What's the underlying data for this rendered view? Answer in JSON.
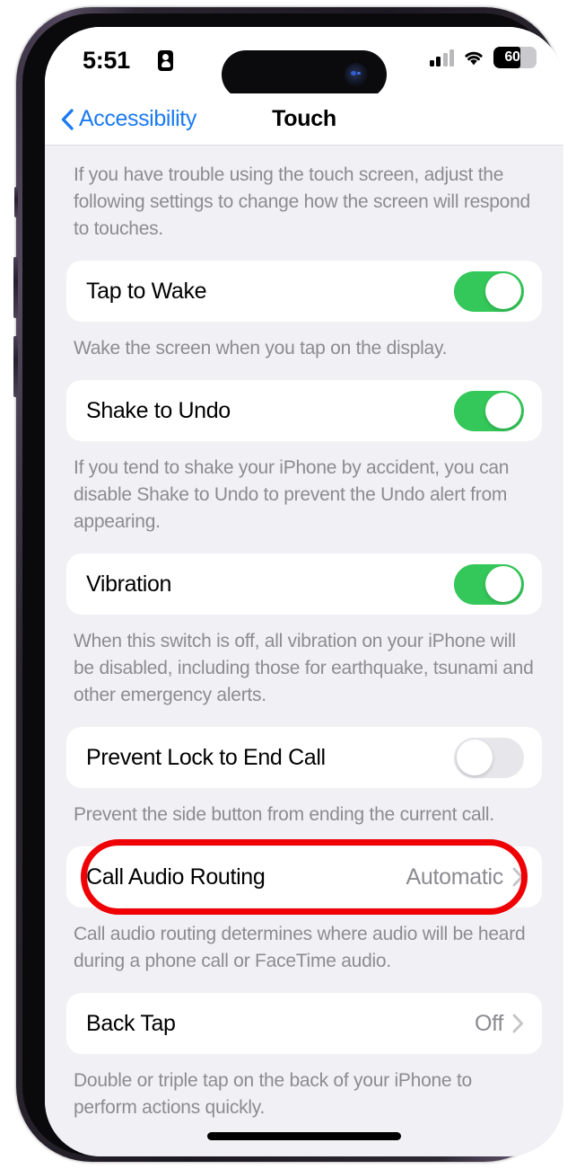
{
  "status_bar": {
    "time": "5:51",
    "lock_icon": "privacy-lock-icon",
    "signal_icon": "cellular-signal-icon",
    "wifi_icon": "wifi-icon",
    "battery_level": "60",
    "battery_percent": 60
  },
  "nav": {
    "back_label": "Accessibility",
    "back_icon": "chevron-left-icon",
    "title": "Touch"
  },
  "intro_text": "If you have trouble using the touch screen, adjust the following settings to change how the screen will respond to touches.",
  "rows": [
    {
      "label": "Tap to Wake",
      "type": "toggle",
      "value": "on",
      "footer": "Wake the screen when you tap on the display."
    },
    {
      "label": "Shake to Undo",
      "type": "toggle",
      "value": "on",
      "footer": "If you tend to shake your iPhone by accident, you can disable Shake to Undo to prevent the Undo alert from appearing."
    },
    {
      "label": "Vibration",
      "type": "toggle",
      "value": "on",
      "footer": "When this switch is off, all vibration on your iPhone will be disabled, including those for earthquake, tsunami and other emergency alerts."
    },
    {
      "label": "Prevent Lock to End Call",
      "type": "toggle",
      "value": "off",
      "footer": "Prevent the side button from ending the current call."
    },
    {
      "label": "Call Audio Routing",
      "type": "disclosure",
      "value": "Automatic",
      "footer": "Call audio routing determines where audio will be heard during a phone call or FaceTime audio.",
      "highlighted": true
    },
    {
      "label": "Back Tap",
      "type": "disclosure",
      "value": "Off",
      "footer": "Double or triple tap on the back of your iPhone to perform actions quickly."
    }
  ],
  "colors": {
    "toggle_on": "#34C759",
    "toggle_off": "#E6E6EB",
    "accent_blue": "#1A7BF2",
    "annotation_red": "#EE0004",
    "background": "#F1F1F5",
    "card": "#FFFFFF",
    "secondary_text": "#8B8B92"
  }
}
